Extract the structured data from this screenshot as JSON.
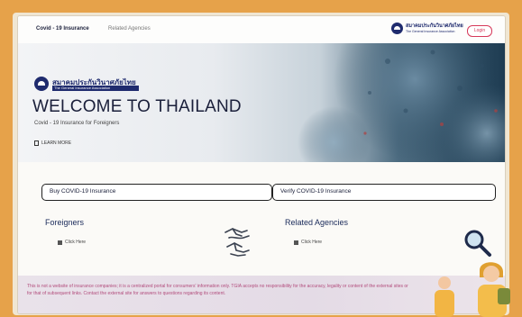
{
  "topbar": {
    "nav_active": "Covid - 19 Insurance",
    "nav_secondary": "Related Agencies",
    "logo_text": "สมาคมประกันวินาศภัยไทย",
    "logo_subtext": "The General Insurance Association",
    "login_label": "Login"
  },
  "hero": {
    "logo_text": "สมาคมประกันวินาศภัยไทย",
    "logo_subtext": "The General Insurance Association",
    "title": "WELCOME TO THAILAND",
    "subtitle": "Covid - 19 Insurance for Foreigners",
    "learn_more": "LEARN MORE"
  },
  "buy_button": "Buy COVID-19 Insurance",
  "verify_button": "Verify COVID-19 Insurance",
  "foreigners": {
    "title": "Foreigners",
    "link": "Click Here"
  },
  "agencies": {
    "title": "Related Agencies",
    "link": "Click Here"
  },
  "footer": {
    "text": "This is not a website of insurance companies; it is a centralized portal for consumers' information only. TGIA accepts no responsibility for the accuracy, legality or content of the external sites or for that of subsequent links. Contact the external site for answers to questions regarding its content."
  },
  "icons": [
    "hands-icon",
    "search-icon",
    "learn-more-icon",
    "click-here-icon"
  ]
}
